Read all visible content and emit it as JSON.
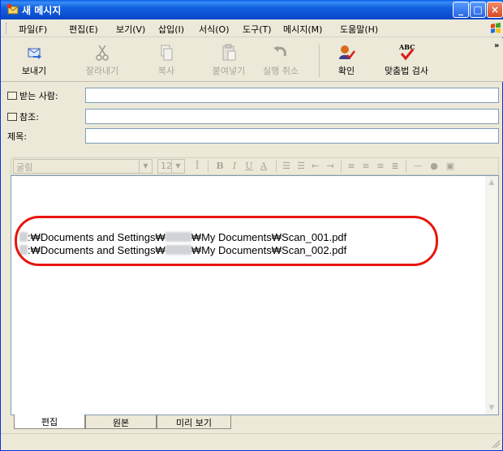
{
  "window": {
    "title": "새 메시지"
  },
  "menu": [
    "파일(F)",
    "편집(E)",
    "보기(V)",
    "삽입(I)",
    "서식(O)",
    "도구(T)",
    "메시지(M)",
    "도움말(H)"
  ],
  "toolbar": {
    "send": "보내기",
    "cut": "잘라내기",
    "copy": "복사",
    "paste": "붙여넣기",
    "undo": "실행 취소",
    "check": "확인",
    "spelling": "맞춤법 검사",
    "abc": "ABC",
    "more": "»"
  },
  "header": {
    "to_label": "받는 사람:",
    "cc_label": "참조:",
    "subject_label": "제목:",
    "to_value": "",
    "cc_value": "",
    "subject_value": ""
  },
  "format": {
    "font": "굴림",
    "size": "12",
    "bold": "B",
    "italic": "I",
    "underline": "U",
    "fontcolor": "A"
  },
  "body": {
    "line1": ":₩Documents and Settings₩",
    "line1_end": "₩My Documents₩Scan_001.pdf",
    "line2": ":₩Documents and Settings₩",
    "line2_end": "₩My Documents₩Scan_002.pdf",
    "highlight_color": "#e8150c"
  },
  "tabs": [
    "편집",
    "원본",
    "미리 보기"
  ],
  "colors": {
    "titlebar": "#0b4fd0",
    "chrome": "#ece9d8",
    "field_border": "#7f9db9"
  }
}
